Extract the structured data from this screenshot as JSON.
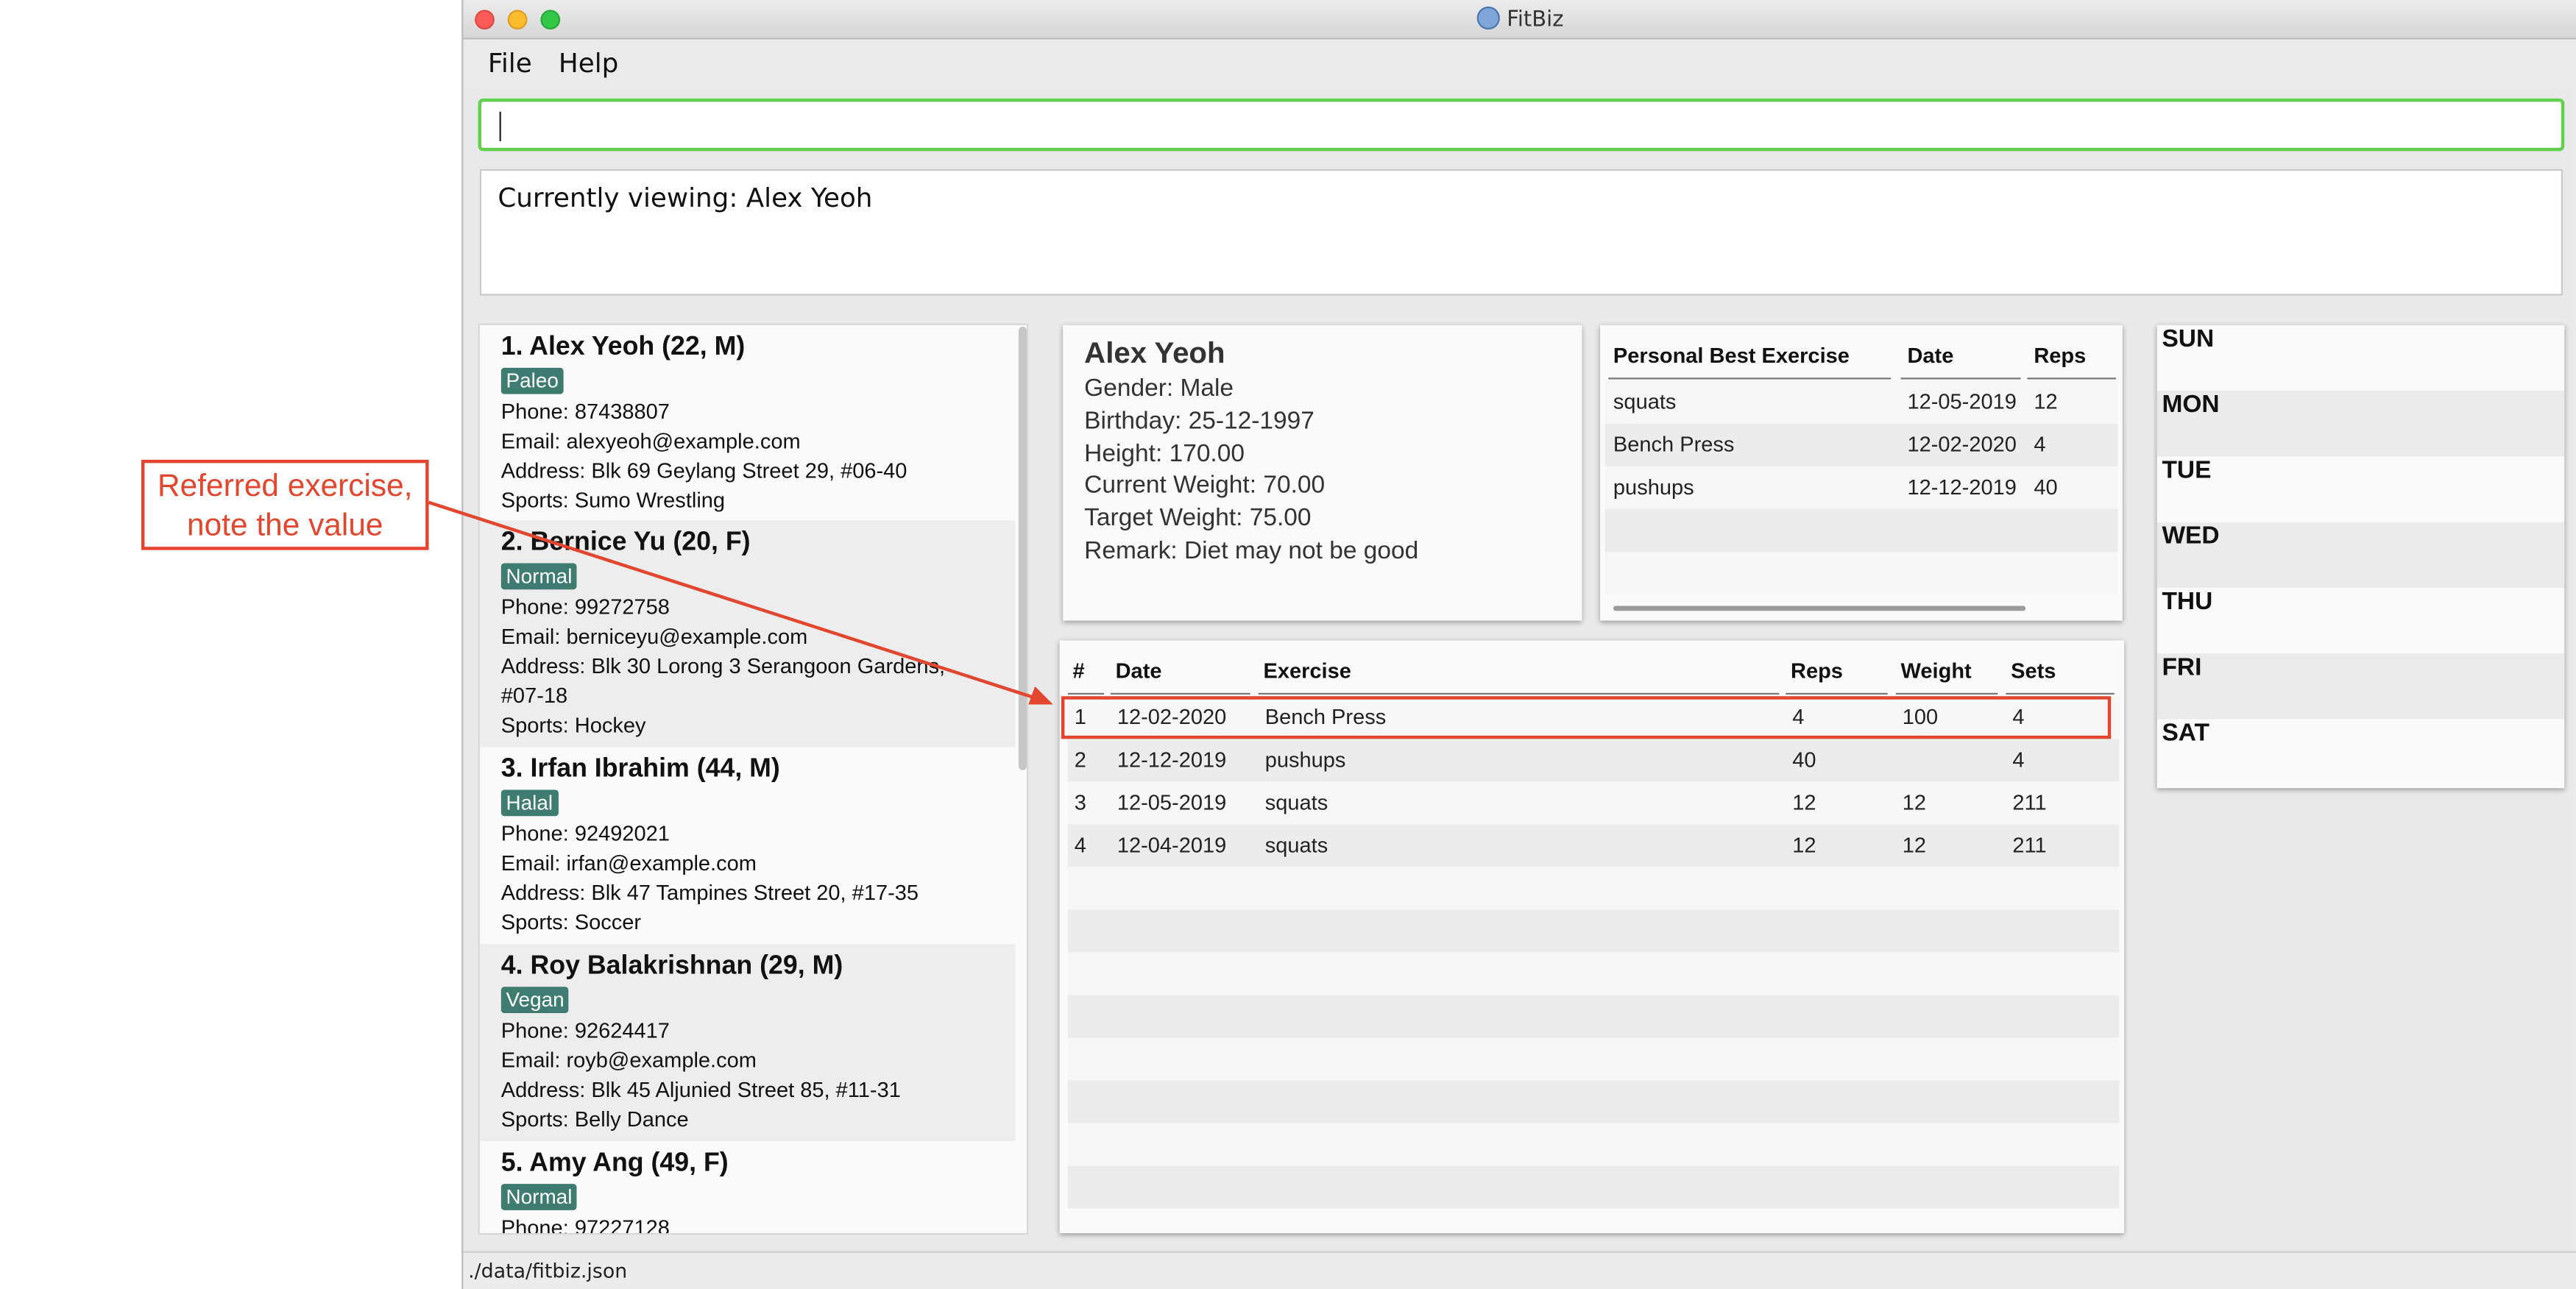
{
  "window": {
    "title": "FitBiz"
  },
  "menu": {
    "file": "File",
    "help": "Help"
  },
  "command_box": {
    "value": ""
  },
  "result_display": {
    "text": "Currently viewing: Alex Yeoh"
  },
  "clients": [
    {
      "name": "1.  Alex Yeoh (22, M)",
      "tag": "Paleo",
      "phone": "Phone: 87438807",
      "email": "Email: alexyeoh@example.com",
      "address": "Address: Blk 69 Geylang Street 29, #06-40",
      "sports": "Sports: Sumo Wrestling"
    },
    {
      "name": "2.  Bernice Yu (20, F)",
      "tag": "Normal",
      "phone": "Phone: 99272758",
      "email": "Email: berniceyu@example.com",
      "address": "Address: Blk 30 Lorong 3 Serangoon Gardens, #07-18",
      "sports": "Sports: Hockey"
    },
    {
      "name": "3.  Irfan Ibrahim (44, M)",
      "tag": "Halal",
      "phone": "Phone: 92492021",
      "email": "Email: irfan@example.com",
      "address": "Address: Blk 47 Tampines Street 20, #17-35",
      "sports": "Sports: Soccer"
    },
    {
      "name": "4.  Roy Balakrishnan (29, M)",
      "tag": "Vegan",
      "phone": "Phone: 92624417",
      "email": "Email: royb@example.com",
      "address": "Address: Blk 45 Aljunied Street 85, #11-31",
      "sports": "Sports: Belly Dance"
    },
    {
      "name": "5.  Amy Ang (49, F)",
      "tag": "Normal",
      "phone": "Phone: 97227128",
      "email": "",
      "address": "",
      "sports": ""
    }
  ],
  "detail": {
    "name": "Alex Yeoh",
    "gender": "Gender: Male",
    "birthday": "Birthday: 25-12-1997",
    "height": "Height: 170.00",
    "current_weight": "Current Weight: 70.00",
    "target_weight": "Target Weight: 75.00",
    "remark": "Remark: Diet may not be good"
  },
  "personal_best": {
    "headers": {
      "exercise": "Personal Best Exercise",
      "date": "Date",
      "reps": "Reps"
    },
    "rows": [
      {
        "exercise": "squats",
        "date": "12-05-2019",
        "reps": "12"
      },
      {
        "exercise": "Bench Press",
        "date": "12-02-2020",
        "reps": "4"
      },
      {
        "exercise": "pushups",
        "date": "12-12-2019",
        "reps": "40"
      }
    ]
  },
  "history": {
    "headers": {
      "num": "#",
      "date": "Date",
      "exercise": "Exercise",
      "reps": "Reps",
      "weight": "Weight",
      "sets": "Sets"
    },
    "rows": [
      {
        "num": "1",
        "date": "12-02-2020",
        "exercise": "Bench Press",
        "reps": "4",
        "weight": "100",
        "sets": "4"
      },
      {
        "num": "2",
        "date": "12-12-2019",
        "exercise": "pushups",
        "reps": "40",
        "weight": "",
        "sets": "4"
      },
      {
        "num": "3",
        "date": "12-05-2019",
        "exercise": "squats",
        "reps": "12",
        "weight": "12",
        "sets": "211"
      },
      {
        "num": "4",
        "date": "12-04-2019",
        "exercise": "squats",
        "reps": "12",
        "weight": "12",
        "sets": "211"
      }
    ]
  },
  "schedule": {
    "days": [
      "SUN",
      "MON",
      "TUE",
      "WED",
      "THU",
      "FRI",
      "SAT"
    ]
  },
  "status_bar": {
    "path": "./data/fitbiz.json"
  },
  "annotation": {
    "line1": "Referred exercise,",
    "line2": "note the value"
  },
  "colors": {
    "tag": "#3e7b70",
    "command_border": "#62d04e",
    "annotation": "#e2462f"
  }
}
